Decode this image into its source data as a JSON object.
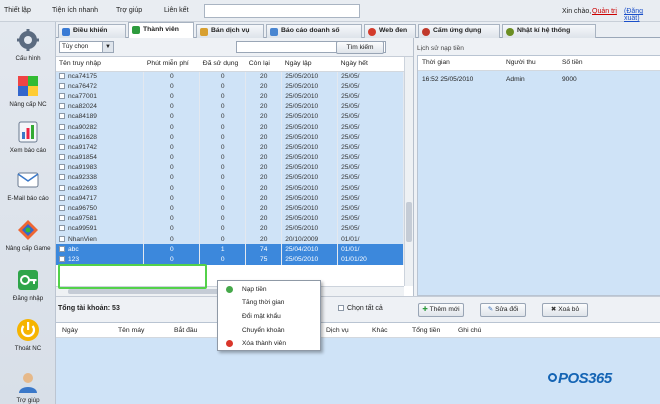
{
  "menu": {
    "items": [
      "Thiết lập",
      "Tiện ích nhanh",
      "Trợ giúp",
      "Liên kết"
    ],
    "greeting": "Xin chào,",
    "user_link": "Quản trị",
    "logout_link": "(Đăng xuất)"
  },
  "sidebar": {
    "items": [
      {
        "label": "Cấu hình",
        "icon": "settings-icon"
      },
      {
        "label": "Nâng cấp NC",
        "icon": "upgrade-icon"
      },
      {
        "label": "Xem báo cáo",
        "icon": "report-icon"
      },
      {
        "label": "E-Mail báo cáo",
        "icon": "email-icon"
      },
      {
        "label": "Nâng cấp Game",
        "icon": "game-icon"
      },
      {
        "label": "Đăng nhập",
        "icon": "login-icon"
      },
      {
        "label": "Thoát NC",
        "icon": "power-icon"
      },
      {
        "label": "Trợ giúp",
        "icon": "help-icon"
      }
    ]
  },
  "tabs": [
    {
      "label": "Điều khiển",
      "icon": "control-icon",
      "color": "#3a7bd5"
    },
    {
      "label": "Thành viên",
      "icon": "members-icon",
      "color": "#2e9b3e"
    },
    {
      "label": "Bán dịch vụ",
      "icon": "cart-icon",
      "color": "#d8a031"
    },
    {
      "label": "Báo cáo doanh số",
      "icon": "chart-icon",
      "color": "#4a86d1"
    },
    {
      "label": "Web đen",
      "icon": "web-block-icon",
      "color": "#d33b2c"
    },
    {
      "label": "Cấm ứng dụng",
      "icon": "block-app-icon",
      "color": "#c0392b"
    },
    {
      "label": "Nhật kí hệ thống",
      "icon": "log-icon",
      "color": "#6b8e23"
    }
  ],
  "members": {
    "filter": "Tùy chọn",
    "search_button": "Tìm kiếm",
    "columns": [
      "Tên truy nhập",
      "Phút miễn phí",
      "Đã sử dụng",
      "Còn lại",
      "Ngày lập",
      "Ngày hết"
    ],
    "rows": [
      [
        "nca74175",
        "0",
        "0",
        "20",
        "25/05/2010",
        "25/05/"
      ],
      [
        "nca76472",
        "0",
        "0",
        "20",
        "25/05/2010",
        "25/05/"
      ],
      [
        "nca77001",
        "0",
        "0",
        "20",
        "25/05/2010",
        "25/05/"
      ],
      [
        "nca82024",
        "0",
        "0",
        "20",
        "25/05/2010",
        "25/05/"
      ],
      [
        "nca84189",
        "0",
        "0",
        "20",
        "25/05/2010",
        "25/05/"
      ],
      [
        "nca90282",
        "0",
        "0",
        "20",
        "25/05/2010",
        "25/05/"
      ],
      [
        "nca91628",
        "0",
        "0",
        "20",
        "25/05/2010",
        "25/05/"
      ],
      [
        "nca91742",
        "0",
        "0",
        "20",
        "25/05/2010",
        "25/05/"
      ],
      [
        "nca91854",
        "0",
        "0",
        "20",
        "25/05/2010",
        "25/05/"
      ],
      [
        "nca91983",
        "0",
        "0",
        "20",
        "25/05/2010",
        "25/05/"
      ],
      [
        "nca92338",
        "0",
        "0",
        "20",
        "25/05/2010",
        "25/05/"
      ],
      [
        "nca92693",
        "0",
        "0",
        "20",
        "25/05/2010",
        "25/05/"
      ],
      [
        "nca94717",
        "0",
        "0",
        "20",
        "25/05/2010",
        "25/05/"
      ],
      [
        "nca96750",
        "0",
        "0",
        "20",
        "25/05/2010",
        "25/05/"
      ],
      [
        "nca97581",
        "0",
        "0",
        "20",
        "25/05/2010",
        "25/05/"
      ],
      [
        "nca99591",
        "0",
        "0",
        "20",
        "25/05/2010",
        "25/05/"
      ],
      [
        "NhanVien",
        "0",
        "0",
        "20",
        "20/10/2009",
        "01/01/"
      ],
      [
        "abc",
        "0",
        "1",
        "74",
        "25/04/2010",
        "01/01/"
      ],
      [
        "123",
        "0",
        "0",
        "75",
        "25/05/2010",
        "01/01/20"
      ]
    ],
    "total_label": "Tổng tài khoản: 53",
    "select_all": "Chọn tất cả",
    "add_button": "Thêm mới",
    "edit_button": "Sửa đổi",
    "delete_button": "Xoá bỏ"
  },
  "history": {
    "title": "Lịch sử nạp tiền",
    "columns": [
      "Thời gian",
      "Người thu",
      "Số tiền"
    ],
    "rows": [
      [
        "16:52 25/05/2010",
        "Admin",
        "9000"
      ]
    ]
  },
  "context_menu": {
    "items": [
      {
        "label": "Nạp tiền",
        "icon": "money-icon",
        "color": "#46a84a"
      },
      {
        "label": "Tăng thời gian",
        "icon": "",
        "color": ""
      },
      {
        "label": "Đổi mật khẩu",
        "icon": "",
        "color": ""
      },
      {
        "label": "Chuyển khoản",
        "icon": "",
        "color": ""
      },
      {
        "label": "Xóa thành viên",
        "icon": "delete-icon",
        "color": "#d9362a"
      }
    ]
  },
  "bottom_table": {
    "columns": [
      "Ngày",
      "Tên máy",
      "Bắt đầu",
      "",
      "Dịch vụ",
      "Khác",
      "Tổng tiền",
      "Ghi chú"
    ]
  },
  "brand": {
    "logo": "POS365",
    "color": "#1464b4"
  }
}
